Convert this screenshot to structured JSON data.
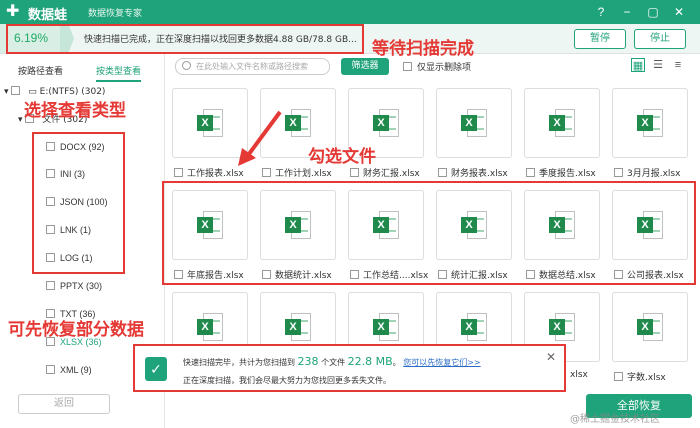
{
  "app": {
    "brand": "数据蛙",
    "subtitle": "数据恢复专家"
  },
  "titlebar": {
    "help_icon": "?",
    "min_icon": "−",
    "restore_icon": "▢",
    "close_icon": "✕"
  },
  "scan": {
    "percent": "6.19%",
    "message": "快速扫描已完成，正在深度扫描以找回更多数据4.88 GB/78.8 GB...",
    "pause_label": "暂停",
    "stop_label": "停止"
  },
  "annotations": {
    "wait": "等待扫描完成",
    "choose_type": "选择查看类型",
    "check_files": "勾选文件",
    "partial": "可先恢复部分数据"
  },
  "sidebar": {
    "tab_path": "按路径查看",
    "tab_type": "按类型查看",
    "drive": "E:(NTFS) (302)",
    "folder": "文件 (302)",
    "types": [
      "DOCX (92)",
      "INI (3)",
      "JSON (100)",
      "LNK (1)",
      "LOG (1)",
      "PPTX (30)",
      "TXT (36)",
      "XLSX (36)",
      "XML (9)"
    ],
    "back_label": "返回"
  },
  "toolbar": {
    "search_placeholder": "在此处输入文件名称或路径搜索",
    "filter_label": "筛选器",
    "only_deleted": "仅显示删除项"
  },
  "files": {
    "row1": [
      "工作报表.xlsx",
      "工作计划.xlsx",
      "财务汇报.xlsx",
      "财务报表.xlsx",
      "季度报告.xlsx",
      "3月月报.xlsx"
    ],
    "row2": [
      "年底报告.xlsx",
      "数据统计.xlsx",
      "工作总结....xlsx",
      "统计汇报.xlsx",
      "数据总结.xlsx",
      "公司报表.xlsx"
    ],
    "row3_last": "字数.xlsx",
    "row3_partial": "xlsx"
  },
  "popup": {
    "line1_pre": "快速扫描完毕，共计为您扫描到",
    "count": "238",
    "line1_mid": "个文件",
    "size": "22.8 MB",
    "line1_post": "。",
    "link": "您可以先恢复它们>>",
    "line2": "正在深度扫描，我们会尽最大努力为您找回更多丢失文件。"
  },
  "recover_all": "全部恢复",
  "watermark": "@稀土掘金技术社区",
  "colors": {
    "accent": "#1fa37a",
    "annotation": "#e53935",
    "excel": "#1f8a4c"
  }
}
